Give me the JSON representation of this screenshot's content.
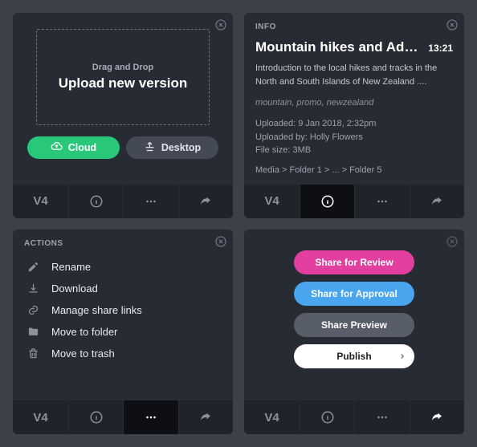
{
  "card1": {
    "dropzone": {
      "line1": "Drag and Drop",
      "line2": "Upload new version"
    },
    "buttons": {
      "cloud": "Cloud",
      "desktop": "Desktop"
    },
    "version": "V4"
  },
  "card2": {
    "headerLabel": "INFO",
    "title": "Mountain hikes and Adve...",
    "duration": "13:21",
    "description": "Introduction to the local hikes and tracks in the North and South Islands of New Zealand ....",
    "tags": "mountain, promo, newzealand",
    "meta": {
      "uploaded": "Uploaded: 9 Jan 2018, 2:32pm",
      "uploadedBy": "Uploaded by:  Holly Flowers",
      "fileSize": "File size: 3MB"
    },
    "path": "Media > Folder 1 > ... > Folder 5",
    "version": "V4"
  },
  "card3": {
    "headerLabel": "ACTIONS",
    "items": [
      {
        "icon": "pencil-icon",
        "label": "Rename"
      },
      {
        "icon": "download-icon",
        "label": "Download"
      },
      {
        "icon": "link-icon",
        "label": "Manage share links"
      },
      {
        "icon": "folder-icon",
        "label": "Move to folder"
      },
      {
        "icon": "trash-icon",
        "label": "Move to trash"
      }
    ],
    "version": "V4"
  },
  "card4": {
    "buttons": {
      "review": "Share for Review",
      "approval": "Share for Approval",
      "preview": "Share Preview",
      "publish": "Publish"
    },
    "version": "V4"
  }
}
